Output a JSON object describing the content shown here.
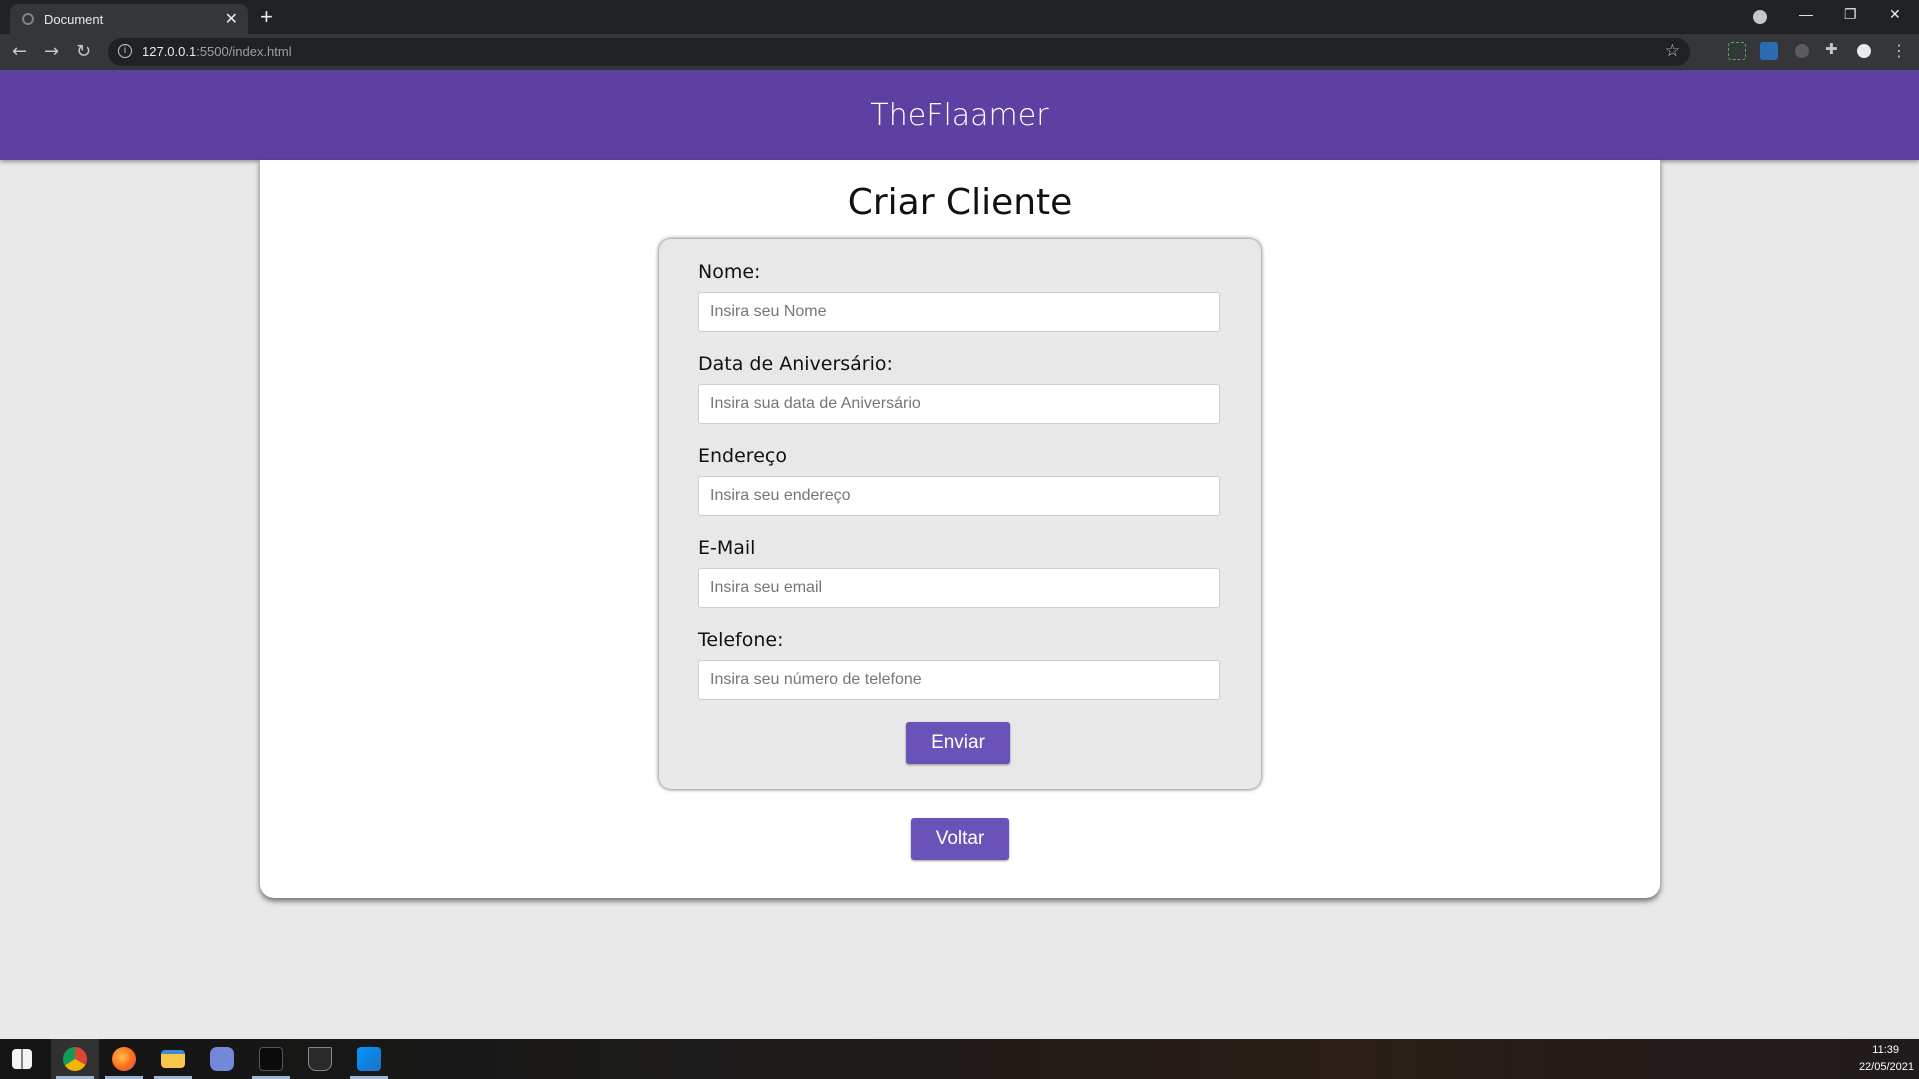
{
  "browser": {
    "tab_title": "Document",
    "new_tab_symbol": "+",
    "url_host": "127.0.0.1",
    "url_path": ":5500/index.html"
  },
  "site": {
    "brand": "TheFlaamer"
  },
  "page": {
    "title": "Criar Cliente"
  },
  "form": {
    "fields": [
      {
        "label": "Nome:",
        "placeholder": "Insira seu Nome",
        "value": ""
      },
      {
        "label": "Data de Aniversário:",
        "placeholder": "Insira sua data de Aniversário",
        "value": ""
      },
      {
        "label": "Endereço",
        "placeholder": "Insira seu endereço",
        "value": ""
      },
      {
        "label": "E-Mail",
        "placeholder": "Insira seu email",
        "value": ""
      },
      {
        "label": "Telefone:",
        "placeholder": "Insira seu número de telefone",
        "value": ""
      }
    ],
    "submit_label": "Enviar"
  },
  "back_label": "Voltar",
  "taskbar": {
    "time": "11:39",
    "date": "22/05/2021",
    "apps": [
      "windows-start-icon",
      "chrome-icon",
      "firefox-icon",
      "file-explorer-icon",
      "discord-icon",
      "terminal-app-icon",
      "epic-games-icon",
      "vscode-icon"
    ]
  },
  "colors": {
    "brand_purple": "#5e3fa2",
    "button_purple": "#6a53b8",
    "page_background": "#e9e9e9",
    "form_background": "#e8e8e8"
  }
}
